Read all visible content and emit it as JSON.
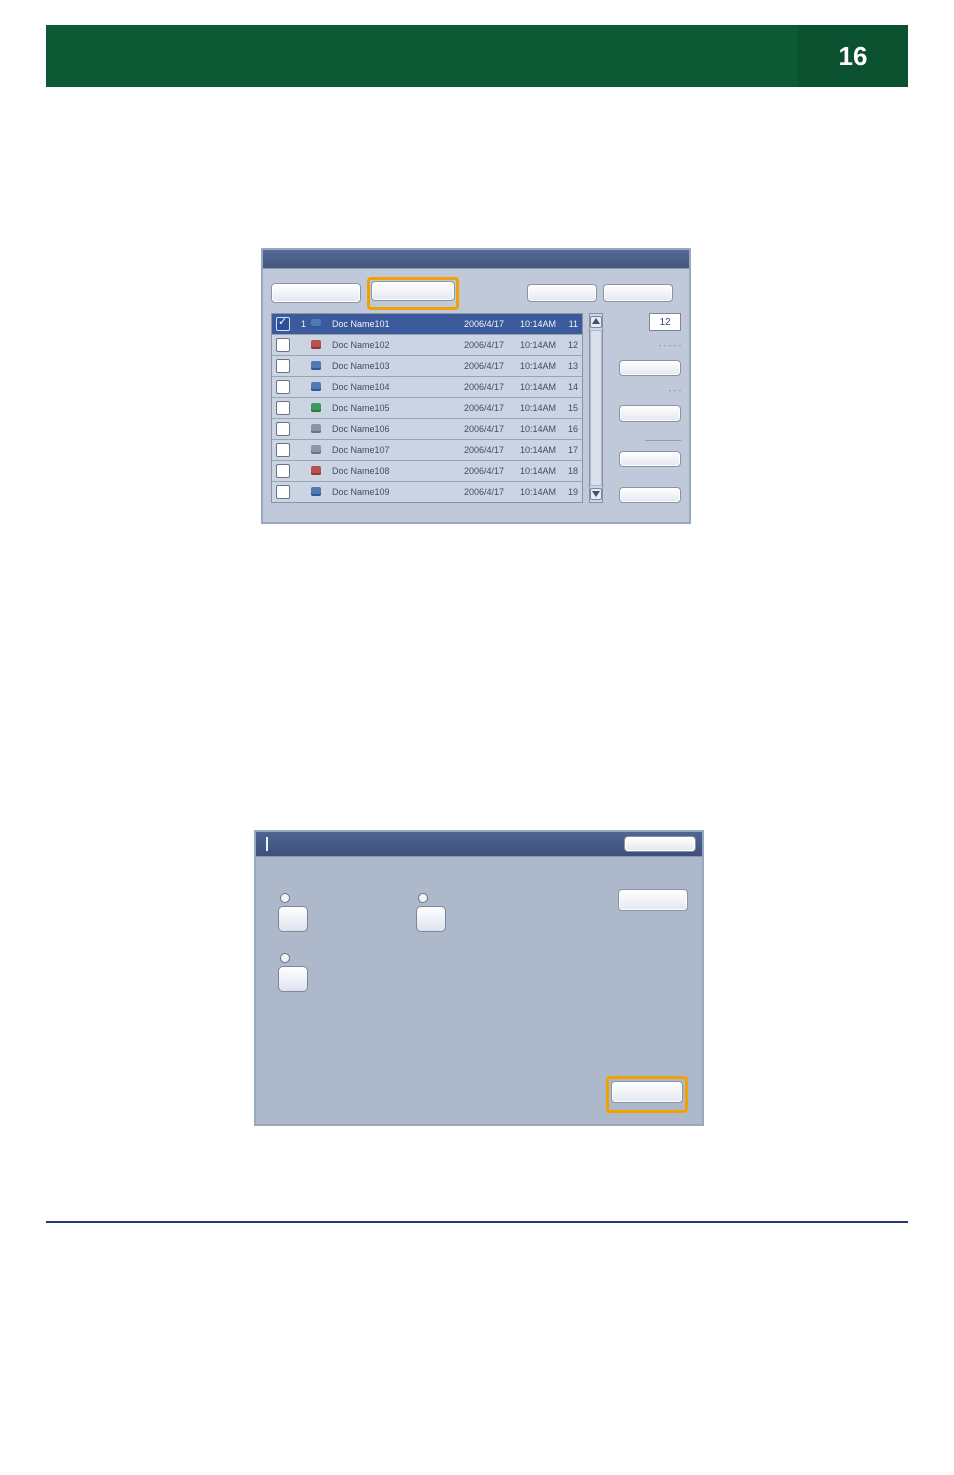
{
  "page_number": "16",
  "panel1": {
    "tabs": {
      "main_label": "",
      "highlighted_label": ""
    },
    "top_buttons": [
      "",
      ""
    ],
    "count_value": "12",
    "side_labels": [
      "- - - - -",
      "- - -",
      "________",
      ""
    ],
    "side_button_labels": [
      "",
      "",
      "",
      ""
    ],
    "rows": [
      {
        "selected": true,
        "index": "1",
        "icon": "ic-blue",
        "name": "Doc Name101",
        "date": "2006/4/17",
        "time": "10:14AM",
        "num": "11"
      },
      {
        "selected": false,
        "index": "",
        "icon": "ic-red",
        "name": "Doc Name102",
        "date": "2006/4/17",
        "time": "10:14AM",
        "num": "12"
      },
      {
        "selected": false,
        "index": "",
        "icon": "ic-blue",
        "name": "Doc Name103",
        "date": "2006/4/17",
        "time": "10:14AM",
        "num": "13"
      },
      {
        "selected": false,
        "index": "",
        "icon": "ic-blue",
        "name": "Doc Name104",
        "date": "2006/4/17",
        "time": "10:14AM",
        "num": "14"
      },
      {
        "selected": false,
        "index": "",
        "icon": "ic-green",
        "name": "Doc Name105",
        "date": "2006/4/17",
        "time": "10:14AM",
        "num": "15"
      },
      {
        "selected": false,
        "index": "",
        "icon": "ic-gray",
        "name": "Doc Name106",
        "date": "2006/4/17",
        "time": "10:14AM",
        "num": "16"
      },
      {
        "selected": false,
        "index": "",
        "icon": "ic-gray",
        "name": "Doc Name107",
        "date": "2006/4/17",
        "time": "10:14AM",
        "num": "17"
      },
      {
        "selected": false,
        "index": "",
        "icon": "ic-red",
        "name": "Doc Name108",
        "date": "2006/4/17",
        "time": "10:14AM",
        "num": "18"
      },
      {
        "selected": false,
        "index": "",
        "icon": "ic-blue",
        "name": "Doc Name109",
        "date": "2006/4/17",
        "time": "10:14AM",
        "num": "19"
      }
    ]
  },
  "panel2": {
    "title": "",
    "top_button": "",
    "right_button": "",
    "confirm_button": "",
    "options": [
      "",
      "",
      ""
    ]
  }
}
